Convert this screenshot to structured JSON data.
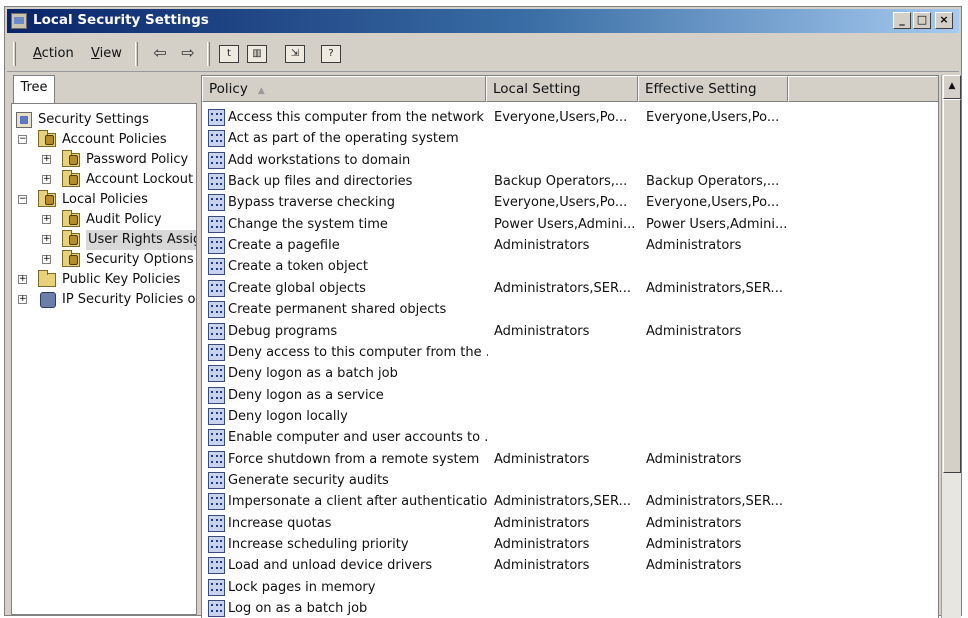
{
  "window": {
    "title": "Local Security Settings",
    "min": "_",
    "max": "□",
    "close": "×"
  },
  "menubar": {
    "action_label": "Action",
    "view_label": "View",
    "back_glyph": "⇦",
    "forward_glyph": "⇨",
    "up_glyph": "t",
    "showhide_glyph": "▥",
    "export_glyph": "⇲",
    "help_glyph": "?"
  },
  "tree": {
    "tab_label": "Tree",
    "items": [
      {
        "label": "Security Settings"
      },
      {
        "label": "Account Policies"
      },
      {
        "label": "Password Policy"
      },
      {
        "label": "Account Lockout P"
      },
      {
        "label": "Local Policies"
      },
      {
        "label": "Audit Policy"
      },
      {
        "label": "User Rights Assign"
      },
      {
        "label": "Security Options"
      },
      {
        "label": "Public Key Policies"
      },
      {
        "label": "IP Security Policies on"
      }
    ]
  },
  "list": {
    "headers": {
      "policy": "Policy",
      "local": "Local Setting",
      "effective": "Effective Setting"
    },
    "rows": [
      {
        "policy": "Access this computer from the network",
        "local": "Everyone,Users,Po...",
        "effective": "Everyone,Users,Po..."
      },
      {
        "policy": "Act as part of the operating system",
        "local": "",
        "effective": ""
      },
      {
        "policy": "Add workstations to domain",
        "local": "",
        "effective": ""
      },
      {
        "policy": "Back up files and directories",
        "local": "Backup Operators,...",
        "effective": "Backup Operators,..."
      },
      {
        "policy": "Bypass traverse checking",
        "local": "Everyone,Users,Po...",
        "effective": "Everyone,Users,Po..."
      },
      {
        "policy": "Change the system time",
        "local": "Power Users,Admini...",
        "effective": "Power Users,Admini..."
      },
      {
        "policy": "Create a pagefile",
        "local": "Administrators",
        "effective": "Administrators"
      },
      {
        "policy": "Create a token object",
        "local": "",
        "effective": ""
      },
      {
        "policy": "Create global objects",
        "local": "Administrators,SER...",
        "effective": "Administrators,SER..."
      },
      {
        "policy": "Create permanent shared objects",
        "local": "",
        "effective": ""
      },
      {
        "policy": "Debug programs",
        "local": "Administrators",
        "effective": "Administrators"
      },
      {
        "policy": "Deny access to this computer from the ...",
        "local": "",
        "effective": ""
      },
      {
        "policy": "Deny logon as a batch job",
        "local": "",
        "effective": ""
      },
      {
        "policy": "Deny logon as a service",
        "local": "",
        "effective": ""
      },
      {
        "policy": "Deny logon locally",
        "local": "",
        "effective": ""
      },
      {
        "policy": "Enable computer and user accounts to ...",
        "local": "",
        "effective": ""
      },
      {
        "policy": "Force shutdown from a remote system",
        "local": "Administrators",
        "effective": "Administrators"
      },
      {
        "policy": "Generate security audits",
        "local": "",
        "effective": ""
      },
      {
        "policy": "Impersonate a client after authentication",
        "local": "Administrators,SER...",
        "effective": "Administrators,SER..."
      },
      {
        "policy": "Increase quotas",
        "local": "Administrators",
        "effective": "Administrators"
      },
      {
        "policy": "Increase scheduling priority",
        "local": "Administrators",
        "effective": "Administrators"
      },
      {
        "policy": "Load and unload device drivers",
        "local": "Administrators",
        "effective": "Administrators"
      },
      {
        "policy": "Lock pages in memory",
        "local": "",
        "effective": ""
      },
      {
        "policy": "Log on as a batch job",
        "local": "",
        "effective": ""
      }
    ]
  },
  "scrollbar": {
    "up_glyph": "▲"
  }
}
